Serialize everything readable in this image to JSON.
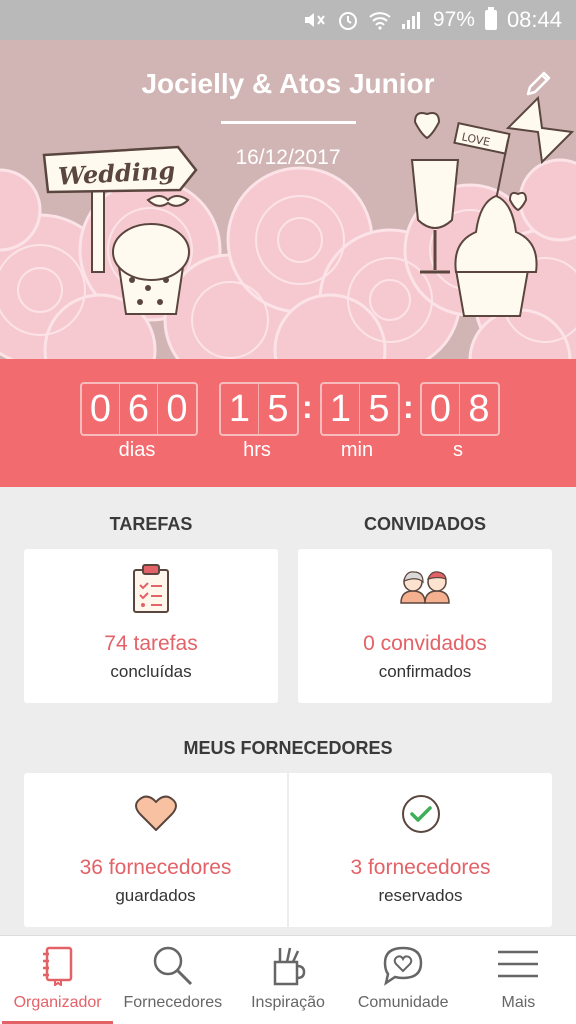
{
  "status_bar": {
    "battery": "97%",
    "time": "08:44",
    "icons": [
      "mute-icon",
      "alarm-icon",
      "wifi-icon",
      "signal-icon",
      "battery-icon"
    ]
  },
  "header": {
    "couple_names": "Jocielly & Atos Junior",
    "wedding_date": "16/12/2017",
    "illustration": {
      "sign_text": "Wedding",
      "flag_text": "LOVE"
    }
  },
  "countdown": {
    "days": [
      "0",
      "6",
      "0"
    ],
    "hours": [
      "1",
      "5"
    ],
    "minutes": [
      "1",
      "5"
    ],
    "seconds": [
      "0",
      "8"
    ],
    "separator": ":",
    "labels": {
      "days": "dias",
      "hours": "hrs",
      "minutes": "min",
      "seconds": "s"
    }
  },
  "tasks": {
    "title": "TAREFAS",
    "count": "74 tarefas",
    "sub": "concluídas"
  },
  "guests": {
    "title": "CONVIDADOS",
    "count": "0 convidados",
    "sub": "confirmados"
  },
  "vendors": {
    "title": "MEUS FORNECEDORES",
    "saved": {
      "count": "36 fornecedores",
      "sub": "guardados"
    },
    "booked": {
      "count": "3 fornecedores",
      "sub": "reservados"
    }
  },
  "nav": {
    "items": [
      {
        "label": "Organizador",
        "icon": "notebook-icon",
        "active": true
      },
      {
        "label": "Fornecedores",
        "icon": "search-icon",
        "active": false
      },
      {
        "label": "Inspiração",
        "icon": "pencil-cup-icon",
        "active": false
      },
      {
        "label": "Comunidade",
        "icon": "chat-heart-icon",
        "active": false
      },
      {
        "label": "Mais",
        "icon": "menu-icon",
        "active": false
      }
    ]
  },
  "colors": {
    "accent": "#f26b6e",
    "accent_text": "#e36267",
    "hero_bg": "#d1b5b4",
    "status_bar": "#b9b9b9"
  }
}
